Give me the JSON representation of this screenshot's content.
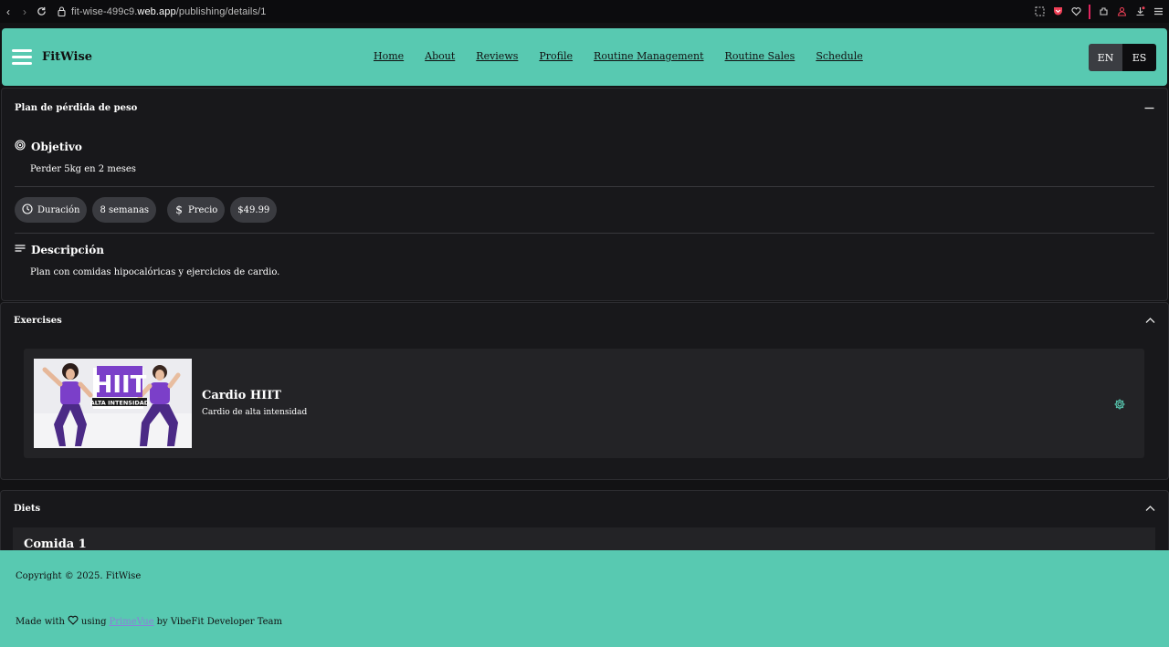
{
  "browser": {
    "url_prefix": "fit-wise-499c9.",
    "url_domain": "web.app",
    "url_path": "/publishing/details/1"
  },
  "header": {
    "brand": "FitWise",
    "nav": [
      "Home",
      "About",
      "Reviews",
      "Profile",
      "Routine Management",
      "Routine Sales",
      "Schedule"
    ],
    "lang_en": "EN",
    "lang_es": "ES"
  },
  "plan": {
    "title": "Plan de pérdida de peso",
    "objective_label": "Objetivo",
    "objective_text": "Perder 5kg en 2 meses",
    "duration_label": "Duración",
    "duration_value": "8 semanas",
    "price_label": "Precio",
    "price_value": "$49.99",
    "description_label": "Descripción",
    "description_text": "Plan con comidas hipocalóricas y ejercicios de cardio."
  },
  "exercises": {
    "title": "Exercises",
    "items": [
      {
        "name": "Cardio HIIT",
        "description": "Cardio de alta intensidad",
        "thumb_text_big": "HIIT",
        "thumb_text_small": "ALTA INTENSIDAD"
      }
    ]
  },
  "diets": {
    "title": "Diets",
    "items": [
      {
        "name": "Comida 1"
      }
    ]
  },
  "footer": {
    "copyright": "Copyright © 2025. FitWise",
    "made_with": "Made with",
    "using": "using",
    "primevue": "PrimeVue",
    "by": "by VibeFit Developer Team"
  },
  "colors": {
    "accent": "#58c9b1",
    "background": "#121214",
    "panel": "#18181b",
    "card": "#232326"
  }
}
